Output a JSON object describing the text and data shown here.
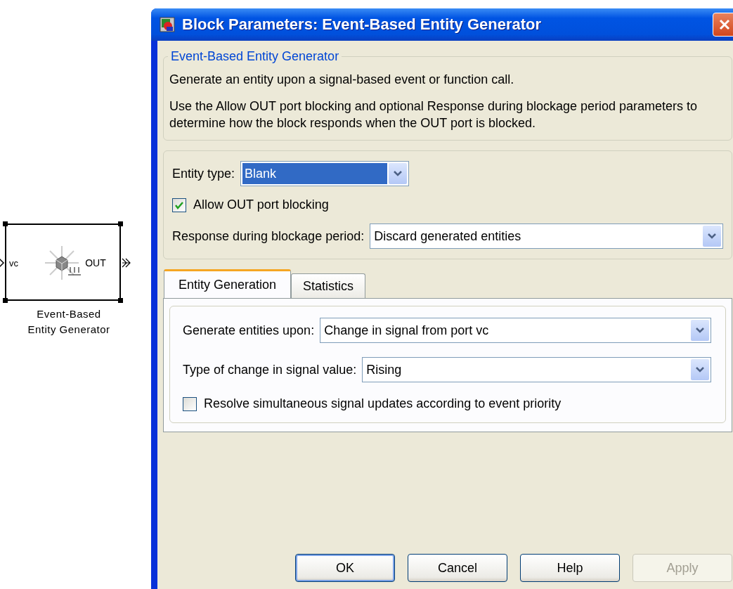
{
  "block": {
    "in_port": "vc",
    "out_port": "OUT",
    "caption": [
      "Event-Based",
      "Entity Generator"
    ]
  },
  "dialog": {
    "title": "Block Parameters: Event-Based Entity Generator",
    "description": {
      "title": "Event-Based Entity Generator",
      "paragraphs": [
        "Generate an entity upon a signal-based event or function call.",
        "Use the Allow OUT port blocking and optional Response during blockage period parameters to determine how the block responds when the OUT port is blocked."
      ]
    },
    "parameters": [
      {
        "kind": "dropdown",
        "label": "Entity type:",
        "value": "Blank",
        "focused": true,
        "wide": false
      },
      {
        "kind": "checkbox",
        "label": "Allow OUT port blocking",
        "checked": true
      },
      {
        "kind": "dropdown",
        "label": "Response during blockage period:",
        "value": "Discard generated entities",
        "focused": false,
        "wide": true
      }
    ],
    "tabs": [
      {
        "label": "Entity Generation",
        "selected": true
      },
      {
        "label": "Statistics",
        "selected": false
      }
    ],
    "tab_fields": [
      {
        "kind": "dropdown",
        "label": "Generate entities upon:",
        "value": "Change in signal from port vc",
        "focused": false,
        "wide": true
      },
      {
        "kind": "dropdown",
        "label": "Type of change in signal value:",
        "value": "Rising",
        "focused": false,
        "wide": true
      },
      {
        "kind": "checkbox",
        "label": "Resolve simultaneous signal updates according to event priority",
        "checked": false
      }
    ],
    "buttons": [
      {
        "label": "OK",
        "default": true,
        "disabled": false
      },
      {
        "label": "Cancel",
        "default": false,
        "disabled": false
      },
      {
        "label": "Help",
        "default": false,
        "disabled": false
      },
      {
        "label": "Apply",
        "default": false,
        "disabled": true
      }
    ]
  }
}
